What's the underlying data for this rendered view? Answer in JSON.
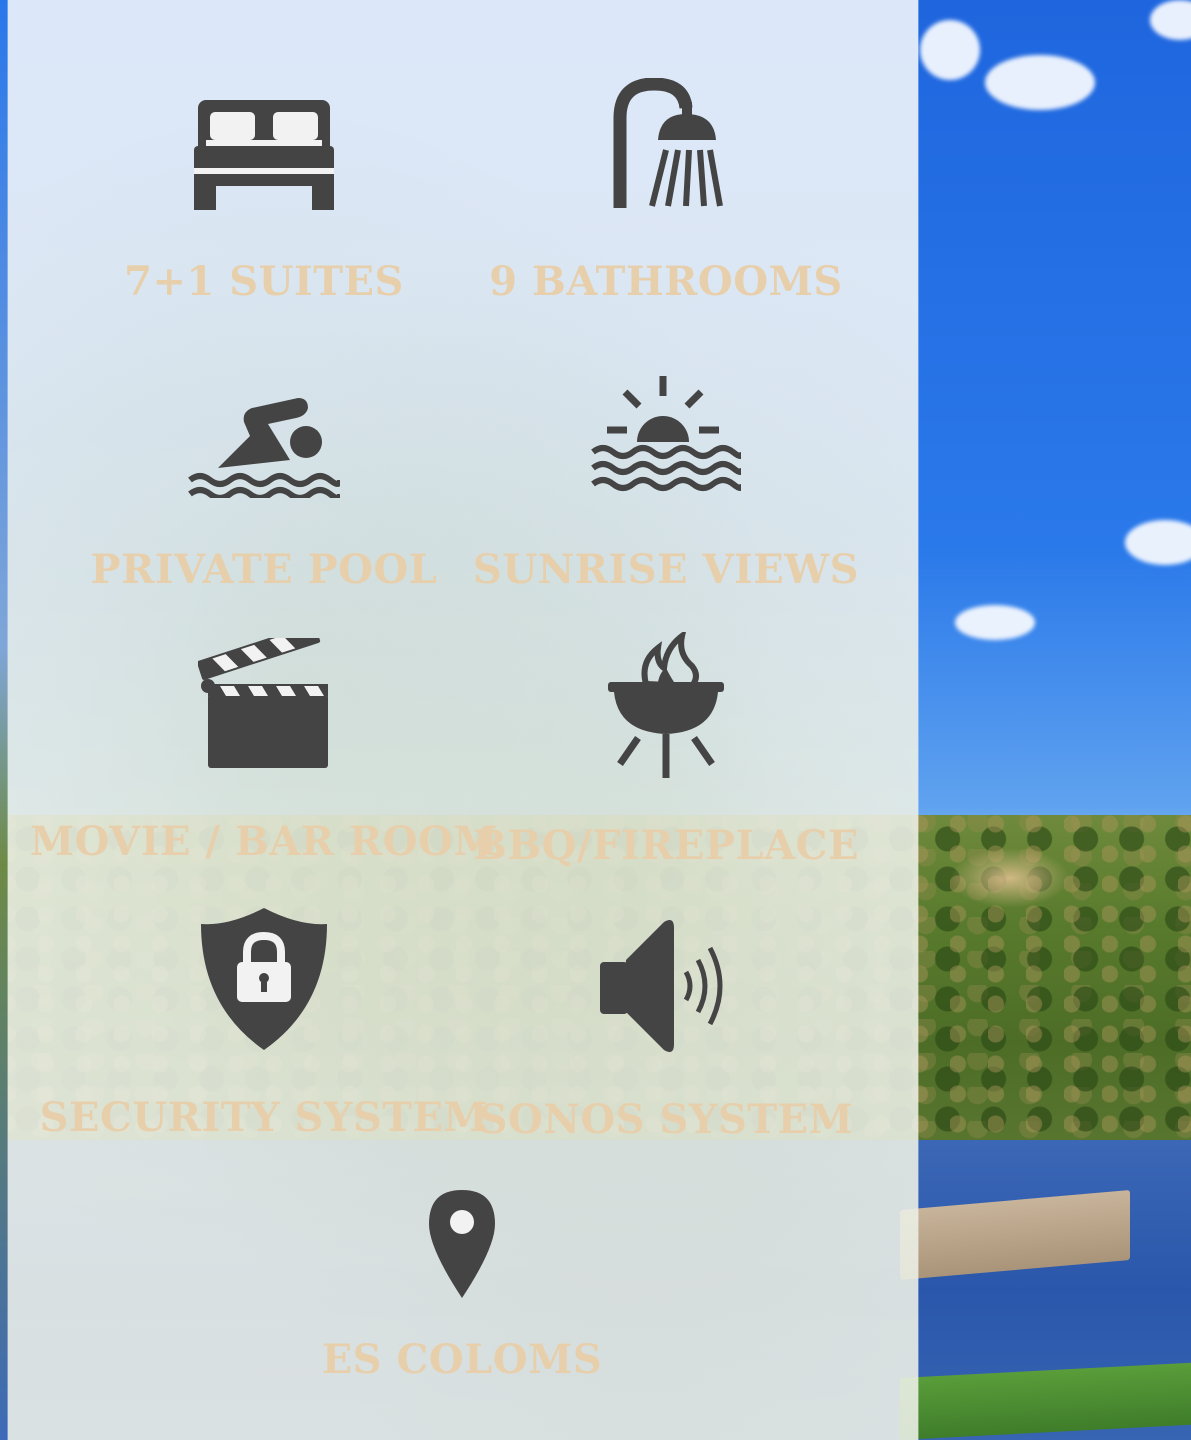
{
  "colors": {
    "icon": "#444444",
    "label": "#e7cfac",
    "panel": "#ffffff",
    "sky": "#2a79ea"
  },
  "features": [
    {
      "label": "7+1 SUITES",
      "icon": "bed-icon"
    },
    {
      "label": "9 BATHROOMS",
      "icon": "shower-icon"
    },
    {
      "label": "PRIVATE POOL",
      "icon": "swimmer-icon"
    },
    {
      "label": "SUNRISE VIEWS",
      "icon": "sunrise-icon"
    },
    {
      "label": "MOVIE / BAR ROOM",
      "icon": "clapperboard-icon"
    },
    {
      "label": "BBQ/FIREPLACE",
      "icon": "bbq-grill-icon"
    },
    {
      "label": "SECURITY SYSTEM",
      "icon": "shield-lock-icon"
    },
    {
      "label": "SONOS SYSTEM",
      "icon": "speaker-icon"
    },
    {
      "label": "ES COLOMS",
      "icon": "map-pin-icon"
    }
  ]
}
